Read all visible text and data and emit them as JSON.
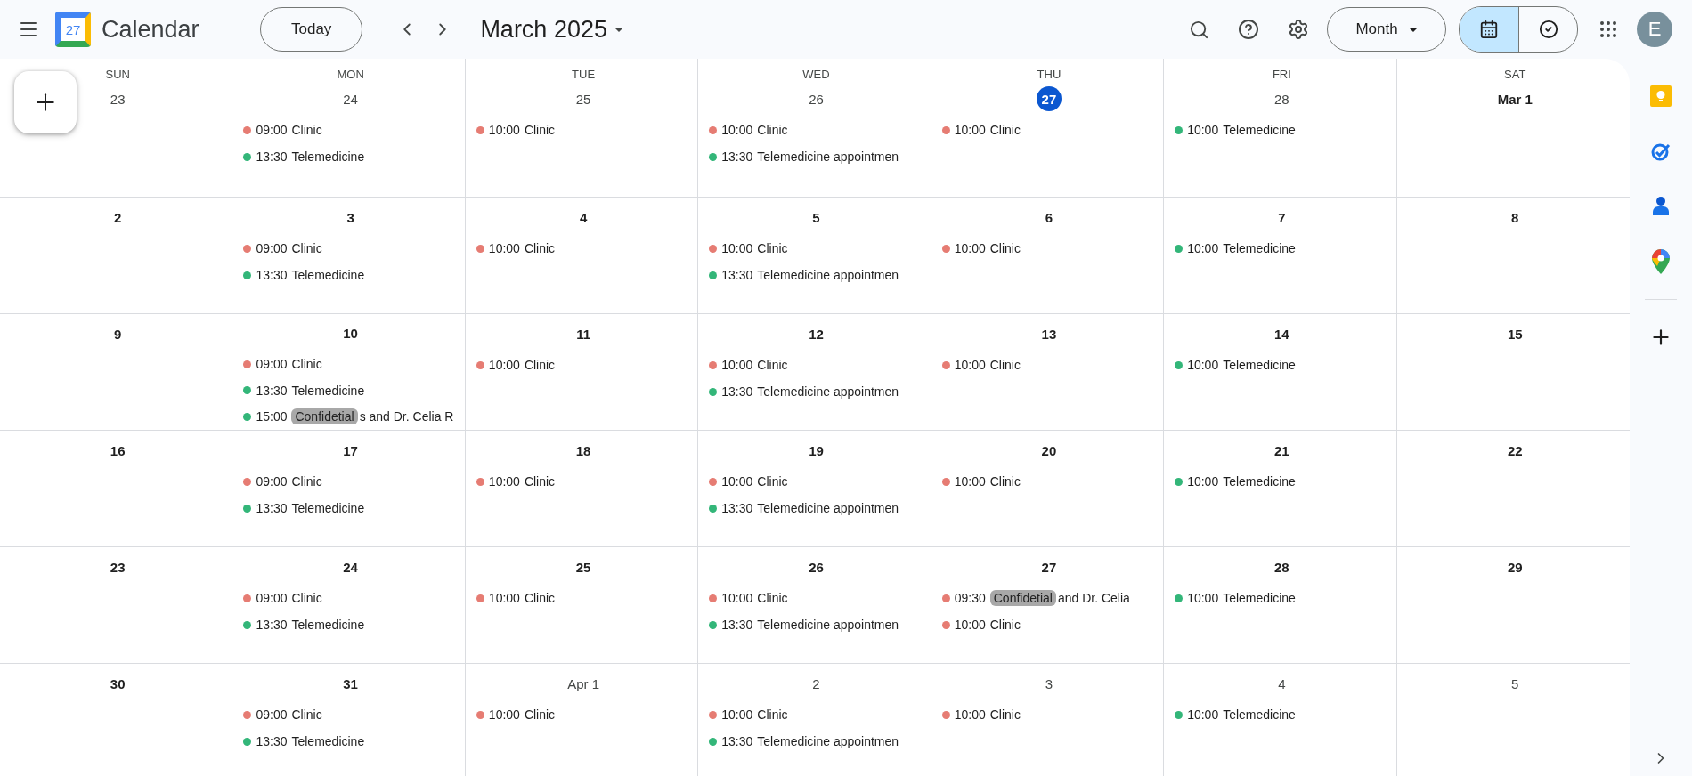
{
  "header": {
    "logo_day": "27",
    "app_name": "Calendar",
    "today_button": "Today",
    "period": "March 2025",
    "view_menu": "Month",
    "view_toggle": [
      {
        "kind": "calendar",
        "selected": true
      },
      {
        "kind": "tasks",
        "selected": false
      }
    ],
    "avatar": "E"
  },
  "weekdays": [
    "SUN",
    "MON",
    "TUE",
    "WED",
    "THU",
    "FRI",
    "SAT"
  ],
  "weeks": [
    {
      "days": [
        {
          "date": "23",
          "other_month": true,
          "today": false
        },
        {
          "date": "24",
          "other_month": true,
          "today": false,
          "events": [
            {
              "time": "09:00",
              "title": "Clinic",
              "color": "#e67c73"
            },
            {
              "time": "13:30",
              "title": "Telemedicine",
              "color": "#33b679"
            }
          ]
        },
        {
          "date": "25",
          "other_month": true,
          "today": false,
          "events": [
            {
              "time": "10:00",
              "title": "Clinic",
              "color": "#e67c73"
            }
          ]
        },
        {
          "date": "26",
          "other_month": true,
          "today": false,
          "events": [
            {
              "time": "10:00",
              "title": "Clinic",
              "color": "#e67c73"
            },
            {
              "time": "13:30",
              "title": "Telemedicine appointmen",
              "color": "#33b679"
            }
          ]
        },
        {
          "date": "27",
          "other_month": true,
          "today": true,
          "events": [
            {
              "time": "10:00",
              "title": "Clinic",
              "color": "#e67c73"
            }
          ]
        },
        {
          "date": "28",
          "other_month": true,
          "today": false,
          "events": [
            {
              "time": "10:00",
              "title": "Telemedicine",
              "color": "#33b679"
            }
          ]
        },
        {
          "date": "Mar 1",
          "other_month": false,
          "today": false
        }
      ]
    },
    {
      "days": [
        {
          "date": "2",
          "other_month": false,
          "today": false
        },
        {
          "date": "3",
          "other_month": false,
          "today": false,
          "events": [
            {
              "time": "09:00",
              "title": "Clinic",
              "color": "#e67c73"
            },
            {
              "time": "13:30",
              "title": "Telemedicine",
              "color": "#33b679"
            }
          ]
        },
        {
          "date": "4",
          "other_month": false,
          "today": false,
          "events": [
            {
              "time": "10:00",
              "title": "Clinic",
              "color": "#e67c73"
            }
          ]
        },
        {
          "date": "5",
          "other_month": false,
          "today": false,
          "events": [
            {
              "time": "10:00",
              "title": "Clinic",
              "color": "#e67c73"
            },
            {
              "time": "13:30",
              "title": "Telemedicine appointmen",
              "color": "#33b679"
            }
          ]
        },
        {
          "date": "6",
          "other_month": false,
          "today": false,
          "events": [
            {
              "time": "10:00",
              "title": "Clinic",
              "color": "#e67c73"
            }
          ]
        },
        {
          "date": "7",
          "other_month": false,
          "today": false,
          "events": [
            {
              "time": "10:00",
              "title": "Telemedicine",
              "color": "#33b679"
            }
          ]
        },
        {
          "date": "8",
          "other_month": false,
          "today": false
        }
      ]
    },
    {
      "days": [
        {
          "date": "9",
          "other_month": false,
          "today": false
        },
        {
          "date": "10",
          "other_month": false,
          "today": false,
          "events": [
            {
              "time": "09:00",
              "title": "Clinic",
              "color": "#e67c73"
            },
            {
              "time": "13:30",
              "title": "Telemedicine",
              "color": "#33b679"
            },
            {
              "time": "15:00",
              "redaction": "Confidetial",
              "title": "s and Dr. Celia R",
              "color": "#33b679"
            }
          ]
        },
        {
          "date": "11",
          "other_month": false,
          "today": false,
          "events": [
            {
              "time": "10:00",
              "title": "Clinic",
              "color": "#e67c73"
            }
          ]
        },
        {
          "date": "12",
          "other_month": false,
          "today": false,
          "events": [
            {
              "time": "10:00",
              "title": "Clinic",
              "color": "#e67c73"
            },
            {
              "time": "13:30",
              "title": "Telemedicine appointmen",
              "color": "#33b679"
            }
          ]
        },
        {
          "date": "13",
          "other_month": false,
          "today": false,
          "events": [
            {
              "time": "10:00",
              "title": "Clinic",
              "color": "#e67c73"
            }
          ]
        },
        {
          "date": "14",
          "other_month": false,
          "today": false,
          "events": [
            {
              "time": "10:00",
              "title": "Telemedicine",
              "color": "#33b679"
            }
          ]
        },
        {
          "date": "15",
          "other_month": false,
          "today": false
        }
      ]
    },
    {
      "days": [
        {
          "date": "16",
          "other_month": false,
          "today": false
        },
        {
          "date": "17",
          "other_month": false,
          "today": false,
          "events": [
            {
              "time": "09:00",
              "title": "Clinic",
              "color": "#e67c73"
            },
            {
              "time": "13:30",
              "title": "Telemedicine",
              "color": "#33b679"
            }
          ]
        },
        {
          "date": "18",
          "other_month": false,
          "today": false,
          "events": [
            {
              "time": "10:00",
              "title": "Clinic",
              "color": "#e67c73"
            }
          ]
        },
        {
          "date": "19",
          "other_month": false,
          "today": false,
          "events": [
            {
              "time": "10:00",
              "title": "Clinic",
              "color": "#e67c73"
            },
            {
              "time": "13:30",
              "title": "Telemedicine appointmen",
              "color": "#33b679"
            }
          ]
        },
        {
          "date": "20",
          "other_month": false,
          "today": false,
          "events": [
            {
              "time": "10:00",
              "title": "Clinic",
              "color": "#e67c73"
            }
          ]
        },
        {
          "date": "21",
          "other_month": false,
          "today": false,
          "events": [
            {
              "time": "10:00",
              "title": "Telemedicine",
              "color": "#33b679"
            }
          ]
        },
        {
          "date": "22",
          "other_month": false,
          "today": false
        }
      ]
    },
    {
      "days": [
        {
          "date": "23",
          "other_month": false,
          "today": false
        },
        {
          "date": "24",
          "other_month": false,
          "today": false,
          "events": [
            {
              "time": "09:00",
              "title": "Clinic",
              "color": "#e67c73"
            },
            {
              "time": "13:30",
              "title": "Telemedicine",
              "color": "#33b679"
            }
          ]
        },
        {
          "date": "25",
          "other_month": false,
          "today": false,
          "events": [
            {
              "time": "10:00",
              "title": "Clinic",
              "color": "#e67c73"
            }
          ]
        },
        {
          "date": "26",
          "other_month": false,
          "today": false,
          "events": [
            {
              "time": "10:00",
              "title": "Clinic",
              "color": "#e67c73"
            },
            {
              "time": "13:30",
              "title": "Telemedicine appointmen",
              "color": "#33b679"
            }
          ]
        },
        {
          "date": "27",
          "other_month": false,
          "today": false,
          "events": [
            {
              "time": "09:30",
              "redaction": "Confidetial",
              "title": "and Dr. Celia",
              "color": "#e67c73"
            },
            {
              "time": "10:00",
              "title": "Clinic",
              "color": "#e67c73"
            }
          ]
        },
        {
          "date": "28",
          "other_month": false,
          "today": false,
          "events": [
            {
              "time": "10:00",
              "title": "Telemedicine",
              "color": "#33b679"
            }
          ]
        },
        {
          "date": "29",
          "other_month": false,
          "today": false
        }
      ]
    },
    {
      "days": [
        {
          "date": "30",
          "other_month": false,
          "today": false
        },
        {
          "date": "31",
          "other_month": false,
          "today": false,
          "events": [
            {
              "time": "09:00",
              "title": "Clinic",
              "color": "#e67c73"
            },
            {
              "time": "13:30",
              "title": "Telemedicine",
              "color": "#33b679"
            }
          ]
        },
        {
          "date": "Apr 1",
          "other_month": true,
          "today": false,
          "events": [
            {
              "time": "10:00",
              "title": "Clinic",
              "color": "#e67c73"
            }
          ]
        },
        {
          "date": "2",
          "other_month": true,
          "today": false,
          "events": [
            {
              "time": "10:00",
              "title": "Clinic",
              "color": "#e67c73"
            },
            {
              "time": "13:30",
              "title": "Telemedicine appointmen",
              "color": "#33b679"
            }
          ]
        },
        {
          "date": "3",
          "other_month": true,
          "today": false,
          "events": [
            {
              "time": "10:00",
              "title": "Clinic",
              "color": "#e67c73"
            }
          ]
        },
        {
          "date": "4",
          "other_month": true,
          "today": false,
          "events": [
            {
              "time": "10:00",
              "title": "Telemedicine",
              "color": "#33b679"
            }
          ]
        },
        {
          "date": "5",
          "other_month": true,
          "today": false
        }
      ]
    }
  ]
}
